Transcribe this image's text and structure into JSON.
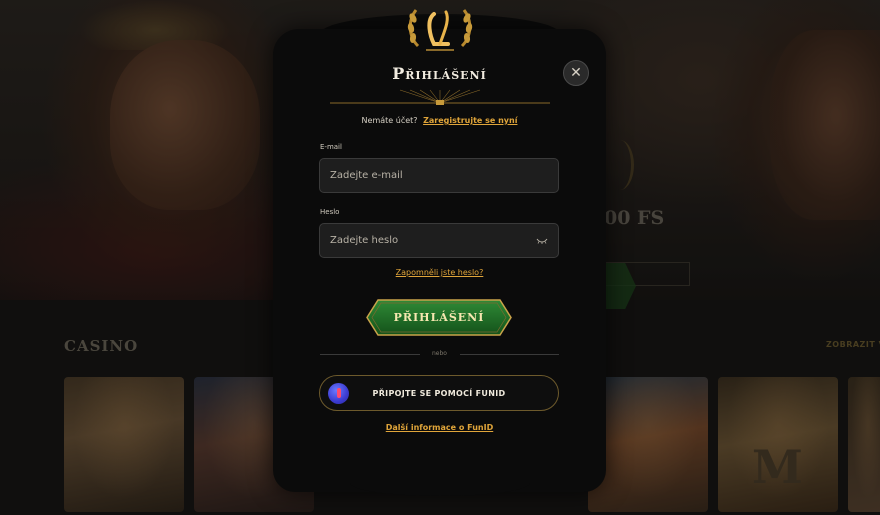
{
  "background": {
    "hero_fs_text": "00 FS",
    "section_title": "Casino",
    "show_all": "ZOBRAZIT V",
    "tile_letter": "M"
  },
  "modal": {
    "title": "Přihlášení",
    "close_icon": "close-icon",
    "register": {
      "question": "Nemáte účet?",
      "link": "Zaregistrujte se nyní"
    },
    "email": {
      "label": "E-mail",
      "placeholder": "Zadejte e-mail",
      "value": ""
    },
    "password": {
      "label": "Heslo",
      "placeholder": "Zadejte heslo",
      "value": "",
      "toggle_icon": "eye-closed-icon"
    },
    "forgot_link": "Zapomněli jste heslo?",
    "login_button": "Přihlášení",
    "or_text": "nebo",
    "funid_button": "PŘIPOJTE SE POMOCÍ FUNID",
    "more_info_link": "Další informace o FunID"
  },
  "colors": {
    "accent": "#e0a53a",
    "button_green": "#1f6b25",
    "button_border": "#c9a34a",
    "modal_bg": "#0b0b0b"
  }
}
